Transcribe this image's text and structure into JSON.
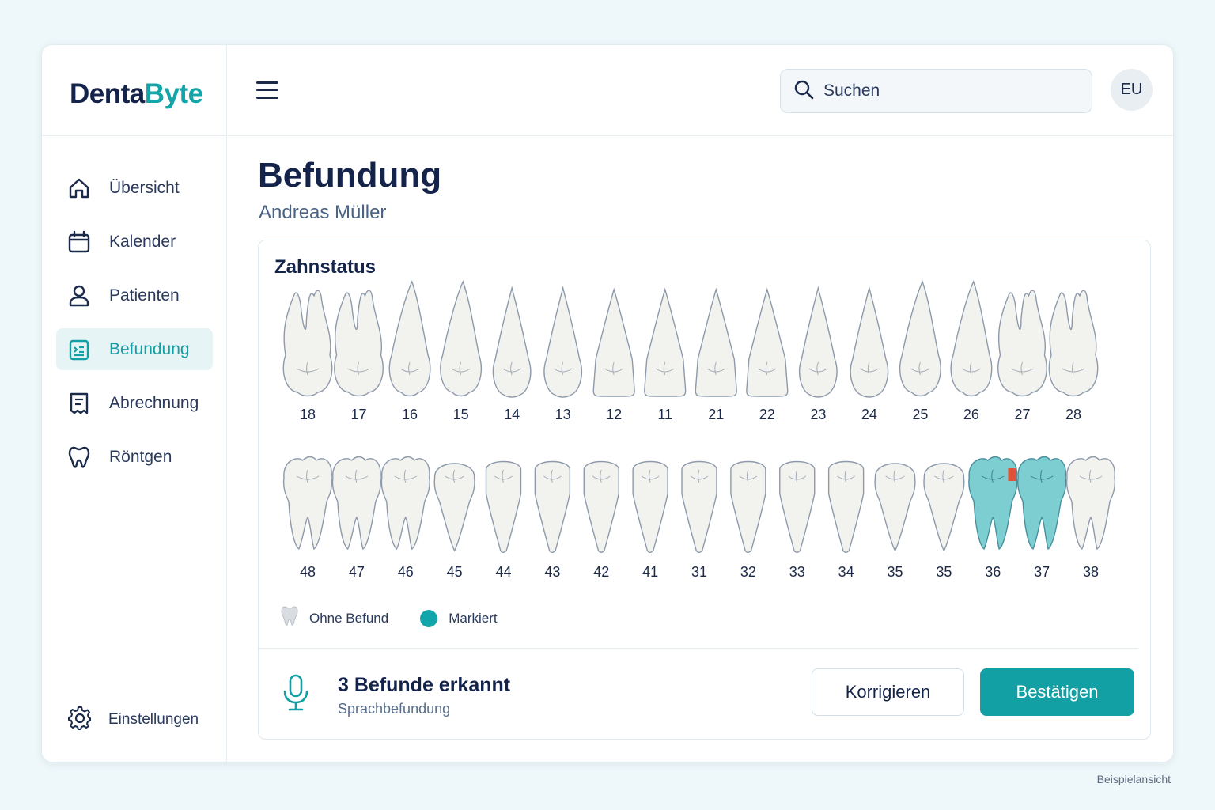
{
  "brand": {
    "part1": "Denta",
    "part2": "Byte"
  },
  "sidebar": {
    "items": [
      {
        "label": "Übersicht",
        "icon": "home-icon",
        "active": false
      },
      {
        "label": "Kalender",
        "icon": "calendar-icon",
        "active": false
      },
      {
        "label": "Patienten",
        "icon": "user-icon",
        "active": false
      },
      {
        "label": "Befundung",
        "icon": "clipboard-icon",
        "active": true
      },
      {
        "label": "Abrechnung",
        "icon": "receipt-icon",
        "active": false
      },
      {
        "label": "Röntgen",
        "icon": "tooth-icon",
        "active": false
      }
    ],
    "settings_label": "Einstellungen"
  },
  "topbar": {
    "search_placeholder": "Suchen",
    "avatar_initials": "EU"
  },
  "page": {
    "title": "Befundung",
    "patient": "Andreas Müller"
  },
  "chart": {
    "title": "Zahnstatus",
    "upper": [
      {
        "num": "18",
        "type": "molar"
      },
      {
        "num": "17",
        "type": "molar"
      },
      {
        "num": "16",
        "type": "premolar"
      },
      {
        "num": "15",
        "type": "premolar"
      },
      {
        "num": "14",
        "type": "canine"
      },
      {
        "num": "13",
        "type": "canine"
      },
      {
        "num": "12",
        "type": "incisor"
      },
      {
        "num": "11",
        "type": "incisor"
      },
      {
        "num": "21",
        "type": "incisor"
      },
      {
        "num": "22",
        "type": "incisor"
      },
      {
        "num": "23",
        "type": "canine"
      },
      {
        "num": "24",
        "type": "canine"
      },
      {
        "num": "25",
        "type": "premolar"
      },
      {
        "num": "26",
        "type": "premolar"
      },
      {
        "num": "27",
        "type": "molar"
      },
      {
        "num": "28",
        "type": "molar"
      }
    ],
    "lower": [
      {
        "num": "48",
        "type": "molar",
        "marked": false
      },
      {
        "num": "47",
        "type": "molar",
        "marked": false
      },
      {
        "num": "46",
        "type": "molar",
        "marked": false
      },
      {
        "num": "45",
        "type": "premolar",
        "marked": false
      },
      {
        "num": "44",
        "type": "incisor",
        "marked": false
      },
      {
        "num": "43",
        "type": "incisor",
        "marked": false
      },
      {
        "num": "42",
        "type": "incisor",
        "marked": false
      },
      {
        "num": "41",
        "type": "incisor",
        "marked": false
      },
      {
        "num": "31",
        "type": "incisor",
        "marked": false
      },
      {
        "num": "32",
        "type": "incisor",
        "marked": false
      },
      {
        "num": "33",
        "type": "incisor",
        "marked": false
      },
      {
        "num": "34",
        "type": "incisor",
        "marked": false
      },
      {
        "num": "35",
        "type": "premolar",
        "marked": false
      },
      {
        "num": "35",
        "type": "premolar",
        "marked": false
      },
      {
        "num": "36",
        "type": "molar",
        "marked": true,
        "lesion": true
      },
      {
        "num": "37",
        "type": "molar",
        "marked": true
      },
      {
        "num": "38",
        "type": "molar",
        "marked": false
      }
    ],
    "legend": {
      "none": "Ohne Befund",
      "marked": "Markiert"
    },
    "colors": {
      "marked": "#12a6aa",
      "lesion": "#e0523a",
      "tooth": "#f2f2ee",
      "outline": "#8e9aab"
    }
  },
  "findings": {
    "title": "3 Befunde erkannt",
    "subtitle": "Sprachbefundung",
    "correct_label": "Korrigieren",
    "confirm_label": "Bestätigen"
  },
  "footnote": "Beispielansicht"
}
